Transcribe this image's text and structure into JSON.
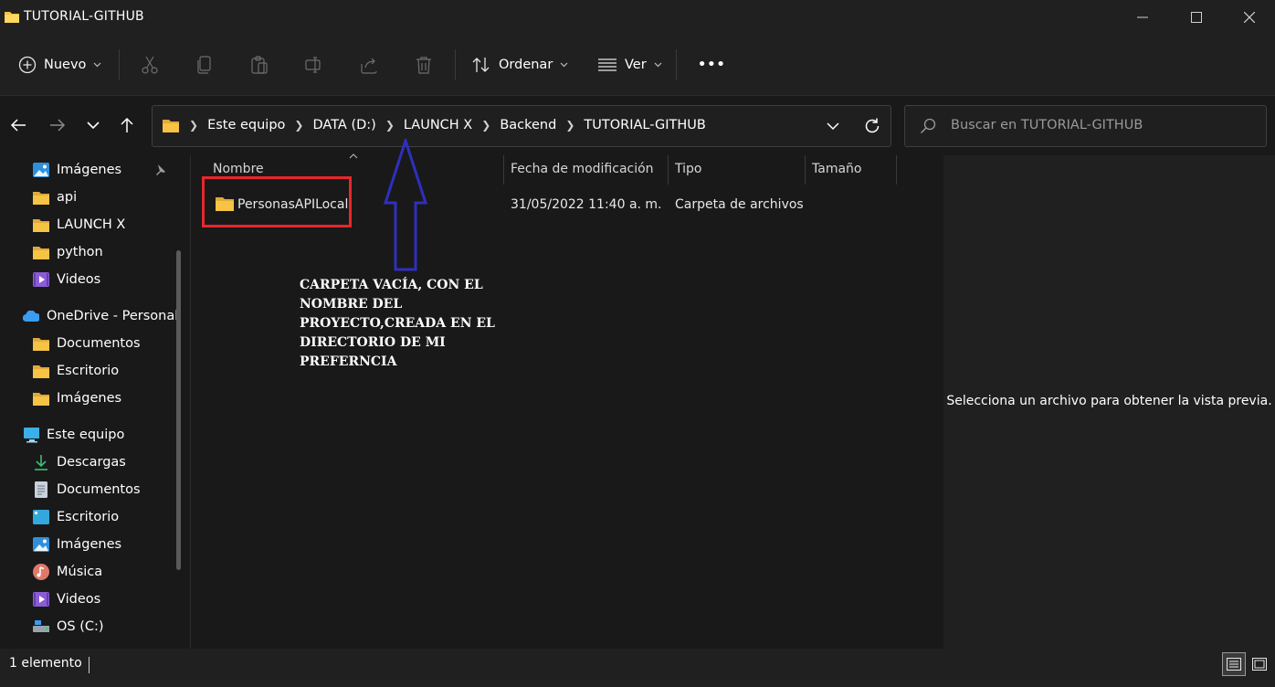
{
  "window": {
    "title": "TUTORIAL-GITHUB"
  },
  "commandbar": {
    "new_label": "Nuevo",
    "sort_label": "Ordenar",
    "view_label": "Ver",
    "more_label": "•••"
  },
  "address": {
    "crumbs": [
      "Este equipo",
      "DATA (D:)",
      "LAUNCH X",
      "Backend",
      "TUTORIAL-GITHUB"
    ]
  },
  "search": {
    "placeholder": "Buscar en TUTORIAL-GITHUB"
  },
  "sidebar": {
    "items": [
      {
        "label": "Imágenes",
        "icon": "pictures-icon"
      },
      {
        "label": "api",
        "icon": "folder-icon"
      },
      {
        "label": "LAUNCH X",
        "icon": "folder-icon"
      },
      {
        "label": "python",
        "icon": "folder-icon"
      },
      {
        "label": "Videos",
        "icon": "videos-icon"
      },
      {
        "label": "OneDrive - Personal",
        "icon": "onedrive-icon"
      },
      {
        "label": "Documentos",
        "icon": "folder-icon"
      },
      {
        "label": "Escritorio",
        "icon": "folder-icon"
      },
      {
        "label": "Imágenes",
        "icon": "folder-icon"
      },
      {
        "label": "Este equipo",
        "icon": "computer-icon"
      },
      {
        "label": "Descargas",
        "icon": "download-icon"
      },
      {
        "label": "Documentos",
        "icon": "documents-icon"
      },
      {
        "label": "Escritorio",
        "icon": "desktop-icon"
      },
      {
        "label": "Imágenes",
        "icon": "pictures-icon"
      },
      {
        "label": "Música",
        "icon": "music-icon"
      },
      {
        "label": "Videos",
        "icon": "videos-icon"
      },
      {
        "label": "OS (C:)",
        "icon": "drive-icon"
      }
    ]
  },
  "filelist": {
    "columns": [
      "Nombre",
      "Fecha de modificación",
      "Tipo",
      "Tamaño"
    ],
    "rows": [
      {
        "name": "PersonasAPILocal",
        "modified": "31/05/2022 11:40 a. m.",
        "type": "Carpeta de archivos",
        "size": ""
      }
    ]
  },
  "preview": {
    "message": "Selecciona un archivo para obtener la vista previa."
  },
  "status": {
    "count": "1 elemento"
  },
  "annotation": {
    "text_lines": [
      "CARPETA VACÍA,  CON EL",
      "NOMBRE DEL",
      "PROYECTO,CREADA EN EL",
      "DIRECTORIO DE MI",
      "PREFERNCIA"
    ],
    "box_color": "#e8262d",
    "arrow_color": "#2f2fbf"
  },
  "colors": {
    "folder": "#f6c344",
    "accent": "#60cdff"
  }
}
